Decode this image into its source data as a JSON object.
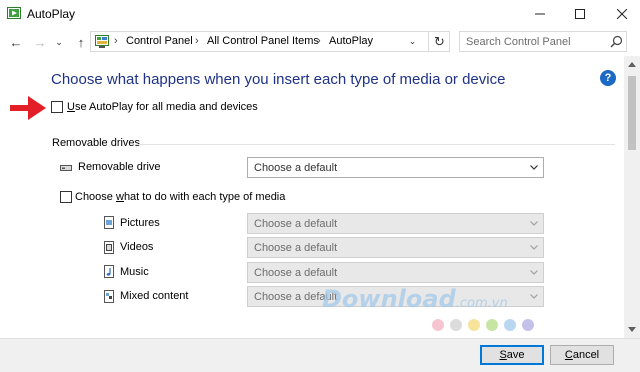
{
  "window": {
    "title": "AutoPlay",
    "controls": {
      "minimize": "—",
      "maximize": "☐",
      "close": "✕"
    }
  },
  "nav": {
    "back": "←",
    "forward": "→",
    "recent": "⌄",
    "up": "↑",
    "breadcrumb_separator": "›",
    "breadcrumbs": [
      "Control Panel",
      "All Control Panel Items",
      "AutoPlay"
    ],
    "address_dropdown": "⌄",
    "refresh": "↻",
    "search_placeholder": "Search Control Panel"
  },
  "main": {
    "heading": "Choose what happens when you insert each type of media or device",
    "help": "?",
    "use_autoplay": {
      "label_prefix": "U",
      "label_rest": "se AutoPlay for all media and devices",
      "checked": false
    },
    "removable_section": {
      "title": "Removable drives",
      "drive_label": "Removable drive",
      "drive_select_value": "Choose a default"
    },
    "per_media": {
      "label_prefix": "Choose ",
      "label_accel": "w",
      "label_rest": "hat to do with each type of media",
      "checked": false,
      "items": [
        {
          "label": "Pictures",
          "icon": "pictures-icon",
          "value": "Choose a default"
        },
        {
          "label": "Videos",
          "icon": "videos-icon",
          "value": "Choose a default"
        },
        {
          "label": "Music",
          "icon": "music-icon",
          "value": "Choose a default"
        },
        {
          "label": "Mixed content",
          "icon": "mixed-content-icon",
          "value": "Choose a default"
        }
      ]
    }
  },
  "footer": {
    "save_accel": "S",
    "save_rest": "ave",
    "cancel_accel": "C",
    "cancel_rest": "ancel"
  },
  "watermark": {
    "text": "Download",
    "tld": ".com.vn",
    "dot_colors": [
      "#f5c6d2",
      "#dcdcdc",
      "#f7e39c",
      "#c7e6a5",
      "#bad7f2",
      "#c5c0ea"
    ]
  },
  "colors": {
    "heading": "#1e3287",
    "help": "#1b69c4",
    "arrow": "#e41e26",
    "accent": "#0078d7"
  }
}
